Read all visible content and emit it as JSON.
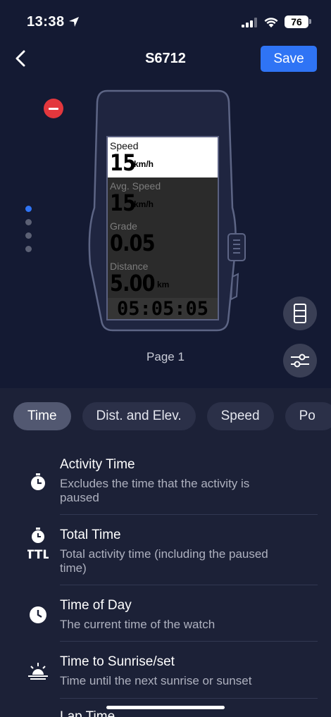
{
  "status_bar": {
    "time": "13:38",
    "battery": "76"
  },
  "nav": {
    "title": "S6712",
    "save_label": "Save"
  },
  "device": {
    "fields": [
      {
        "label": "Speed",
        "value": "15",
        "unit": "km/h"
      },
      {
        "label": "Avg. Speed",
        "value": "15",
        "unit": "km/h"
      },
      {
        "label": "Grade",
        "value": "0.05",
        "unit": ""
      },
      {
        "label": "Distance",
        "value": "5.00",
        "unit": "km"
      }
    ],
    "footer_time": "05:05:05",
    "page_label": "Page 1",
    "page_count": 4,
    "active_page": 1
  },
  "tabs": [
    {
      "label": "Time",
      "active": true
    },
    {
      "label": "Dist. and Elev.",
      "active": false
    },
    {
      "label": "Speed",
      "active": false
    },
    {
      "label": "Po",
      "active": false
    }
  ],
  "items": [
    {
      "title": "Activity Time",
      "desc": "Excludes the time that the activity is paused",
      "icon": "stopwatch-icon"
    },
    {
      "title": "Total Time",
      "desc": "Total activity time (including the paused time)",
      "icon": "stopwatch-ttl-icon"
    },
    {
      "title": "Time of Day",
      "desc": "The current time of the watch",
      "icon": "clock-icon"
    },
    {
      "title": "Time to Sunrise/set",
      "desc": "Time until the next sunrise or sunset",
      "icon": "sunrise-icon"
    },
    {
      "title": "Lap Time",
      "desc": "",
      "icon": "lap-icon"
    }
  ],
  "colors": {
    "accent": "#2f74f5",
    "background": "#141a33",
    "panel": "#1c2137",
    "remove": "#e3373d"
  }
}
